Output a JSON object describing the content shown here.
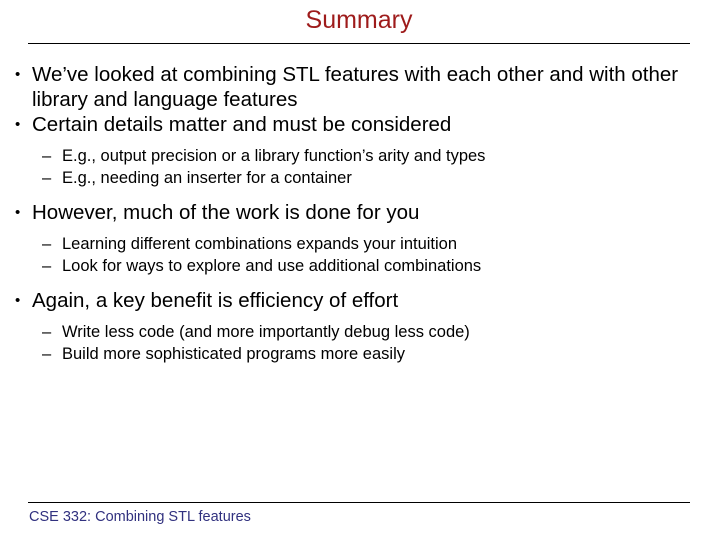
{
  "slide": {
    "title": "Summary",
    "title_color": "#9e1b1b",
    "rule_color": "#000000",
    "background_color": "#ffffff",
    "body_text_color": "#000000",
    "bullet_marker": "•",
    "dash_marker": "–",
    "content": [
      {
        "level": 1,
        "text": "We’ve looked at combining STL features with each other and with other library and language features"
      },
      {
        "level": 1,
        "text": "Certain details matter and must be considered"
      },
      {
        "level": 2,
        "text": "E.g., output precision or a library function’s arity and types"
      },
      {
        "level": 2,
        "text": "E.g., needing an inserter for a container"
      },
      {
        "level": 1,
        "text": "However, much of the work is done for you"
      },
      {
        "level": 2,
        "text": "Learning different combinations expands your intuition"
      },
      {
        "level": 2,
        "text": "Look for ways to explore and use additional combinations"
      },
      {
        "level": 1,
        "text": "Again, a key benefit is efficiency of effort"
      },
      {
        "level": 2,
        "text": "Write less code (and more importantly debug less code)"
      },
      {
        "level": 2,
        "text": "Build more sophisticated programs more easily"
      }
    ],
    "footer": {
      "text": "CSE 332: Combining STL features",
      "color": "#31317f"
    }
  }
}
